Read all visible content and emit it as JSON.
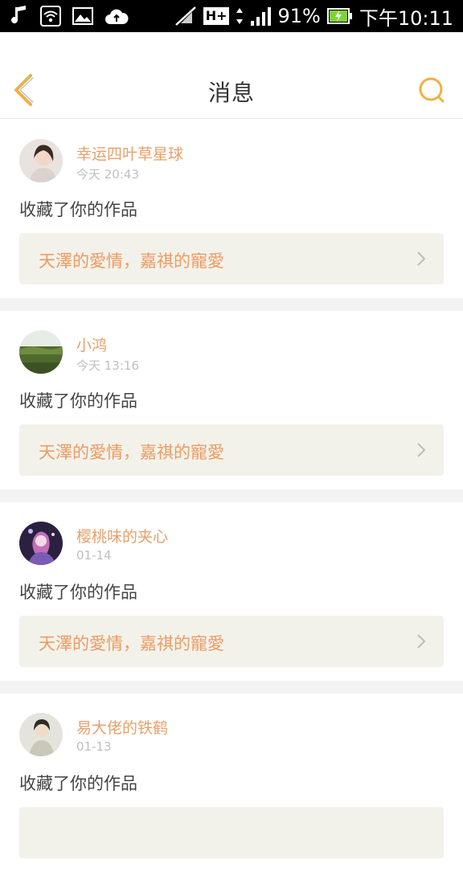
{
  "status_bar": {
    "signal_type": "H+",
    "battery": "91%",
    "time": "下午10:11",
    "left_icons": [
      "music-note-icon",
      "wifi-icon",
      "image-icon",
      "cloud-upload-icon"
    ]
  },
  "nav": {
    "title": "消息",
    "back_icon": "chevron-left-icon",
    "search_icon": "search-icon",
    "accent": "#f0b046"
  },
  "messages": [
    {
      "user": "幸运四叶草星球",
      "time": "今天 20:43",
      "action": "收藏了你的作品",
      "work": "天澤的愛情，嘉祺的寵愛"
    },
    {
      "user": "小鸿",
      "time": "今天 13:16",
      "action": "收藏了你的作品",
      "work": "天澤的愛情，嘉祺的寵愛"
    },
    {
      "user": "樱桃味的夹心",
      "time": "01-14",
      "action": "收藏了你的作品",
      "work": "天澤的愛情，嘉祺的寵愛"
    },
    {
      "user": "易大佬的铁鹤",
      "time": "01-13",
      "action": "收藏了你的作品",
      "work": ""
    }
  ],
  "colors": {
    "username": "#e8a06a",
    "work_title": "#ec9b63",
    "work_bg": "#f3f2ea",
    "separator": "#f3f3f3"
  }
}
